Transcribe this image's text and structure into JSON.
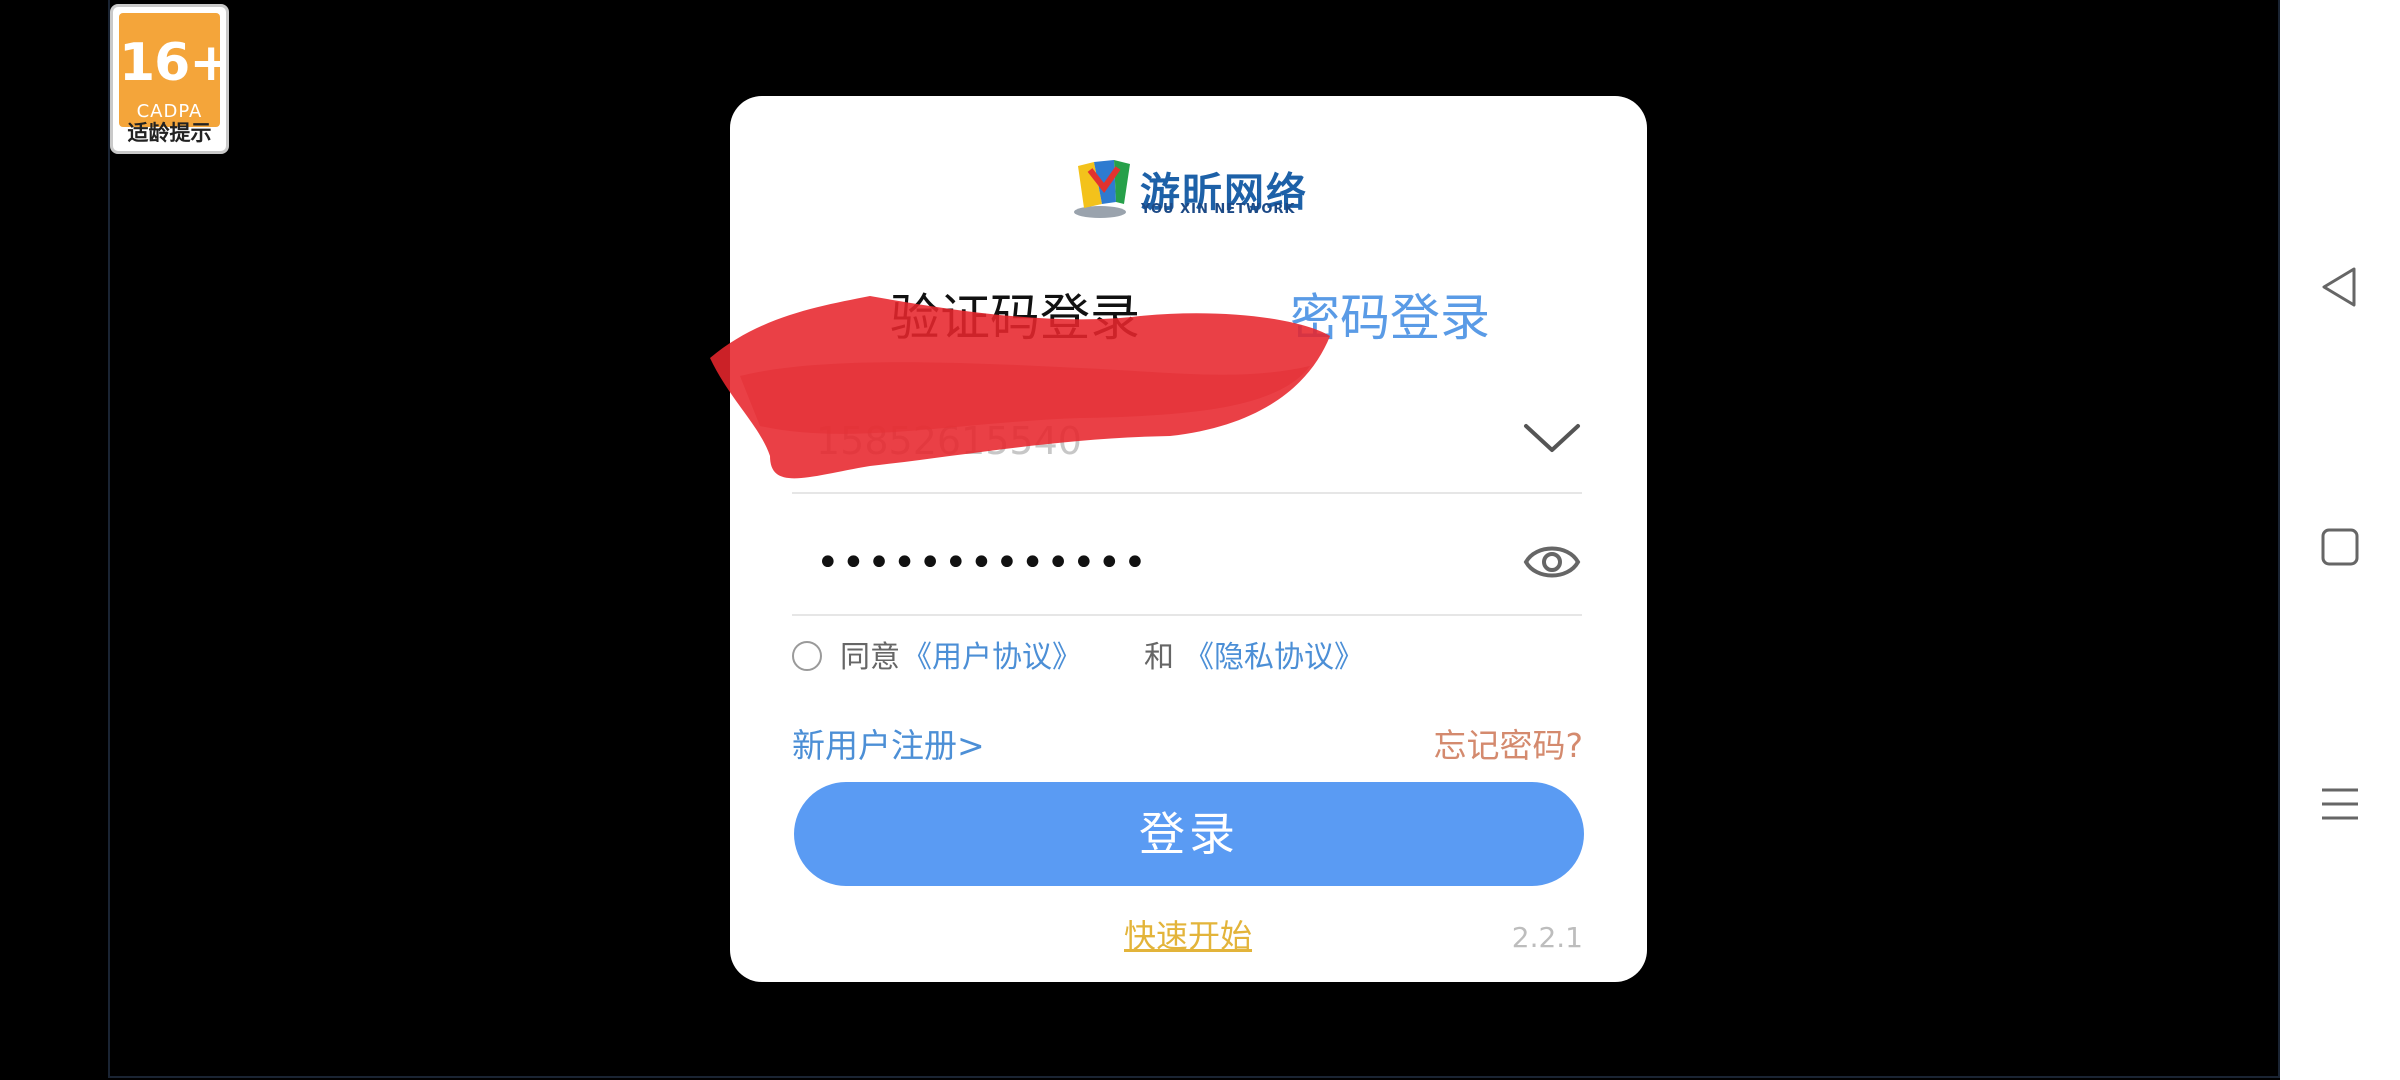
{
  "age_rating": {
    "number": "16+",
    "org": "CADPA",
    "note": "适龄提示"
  },
  "logo": {
    "name_cn": "游昕网络",
    "name_en": "YOU XIN NETWORK"
  },
  "tabs": {
    "sms_login": "验证码登录",
    "password_login": "密码登录"
  },
  "phone": {
    "value": "15852615540"
  },
  "password": {
    "value": "•••••••••••••"
  },
  "agreement": {
    "prefix": "同意",
    "user_agreement": "《用户协议》",
    "and": "和",
    "privacy_agreement": "《隐私协议》",
    "checked": false
  },
  "links": {
    "register": "新用户注册>",
    "forgot_password": "忘记密码?"
  },
  "login_button": "登录",
  "quick_start": "快速开始",
  "version": "2.2.1",
  "colors": {
    "primary": "#5a9bf3",
    "link": "#4c8fd6",
    "forgot": "#d48a6e",
    "quick_start": "#e3b43a",
    "badge": "#f4a53a"
  },
  "nav_icons": [
    "back-triangle-icon",
    "home-square-icon",
    "menu-lines-icon"
  ]
}
